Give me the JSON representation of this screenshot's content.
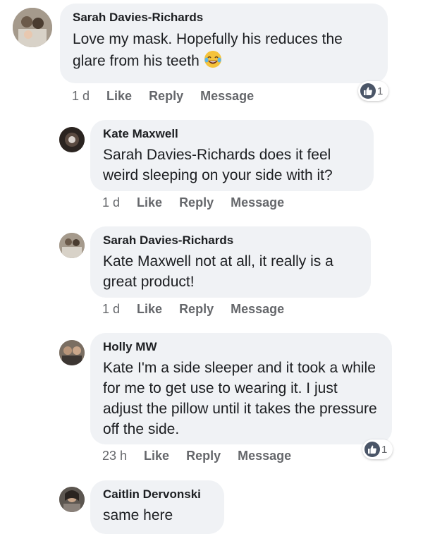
{
  "comments": [
    {
      "author": "Sarah Davies-Richards",
      "text": "Love my mask. Hopefully his reduces the glare from his teeth",
      "emoji": "laughing-tears-emoji",
      "time": "1 d",
      "like": "Like",
      "reply": "Reply",
      "message": "Message",
      "reaction": {
        "icon": "thumbs-up-icon",
        "count": "1"
      }
    },
    {
      "author": "Kate Maxwell",
      "text": "Sarah Davies-Richards does it feel weird sleeping on your side with it?",
      "time": "1 d",
      "like": "Like",
      "reply": "Reply",
      "message": "Message"
    },
    {
      "author": "Sarah Davies-Richards",
      "text": "Kate Maxwell not at all, it really is a great product!",
      "time": "1 d",
      "like": "Like",
      "reply": "Reply",
      "message": "Message"
    },
    {
      "author": "Holly MW",
      "text": "Kate I'm a side sleeper and it took a while for me to get use to wearing it. I just adjust the pillow until it takes the pressure off the side.",
      "time": "23 h",
      "like": "Like",
      "reply": "Reply",
      "message": "Message",
      "reaction": {
        "icon": "thumbs-up-icon",
        "count": "1"
      }
    },
    {
      "author": "Caitlin Dervonski",
      "text": "same here"
    }
  ],
  "colors": {
    "bubble": "#f0f2f5",
    "meta_text": "#65676b",
    "like_badge": "#4a5567"
  }
}
